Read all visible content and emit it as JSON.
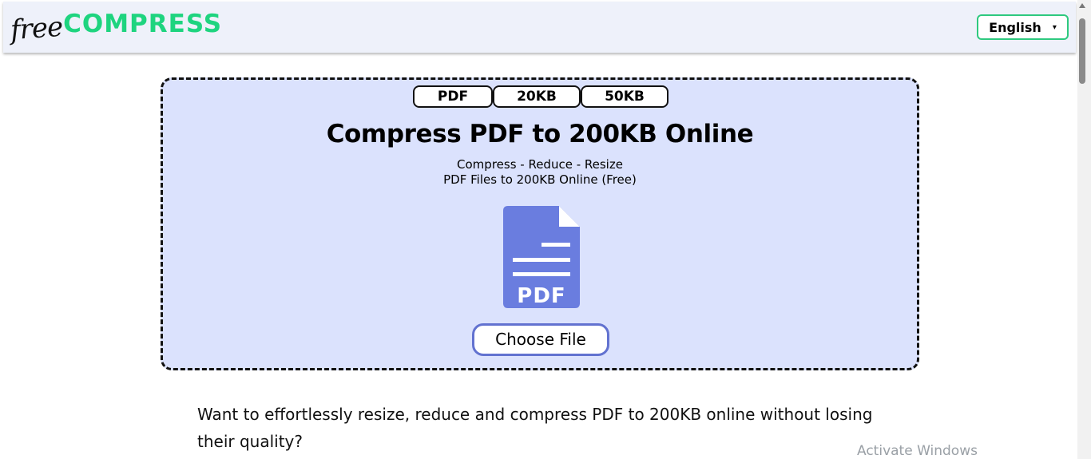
{
  "header": {
    "logo_free": "free",
    "logo_compress": "COMPRESS",
    "language": {
      "selected": "English",
      "caret": "▾"
    }
  },
  "upload": {
    "tabs": [
      {
        "label": "PDF"
      },
      {
        "label": "20KB"
      },
      {
        "label": "50KB"
      }
    ],
    "title": "Compress PDF to 200KB Online",
    "subtitle_line1": "Compress - Reduce - Resize",
    "subtitle_line2": "PDF Files to 200KB Online (Free)",
    "icon": {
      "name": "pdf-file-icon",
      "label": "PDF",
      "color": "#6a7ddf"
    },
    "choose_button": "Choose File"
  },
  "content": {
    "description": "Want to effortlessly resize, reduce and compress PDF to 200KB online without losing their quality?"
  },
  "system": {
    "watermark": "Activate Windows"
  },
  "colors": {
    "brand_green": "#1ed47f",
    "box_bg": "#dbe2fd",
    "accent_blue": "#6272d0"
  }
}
